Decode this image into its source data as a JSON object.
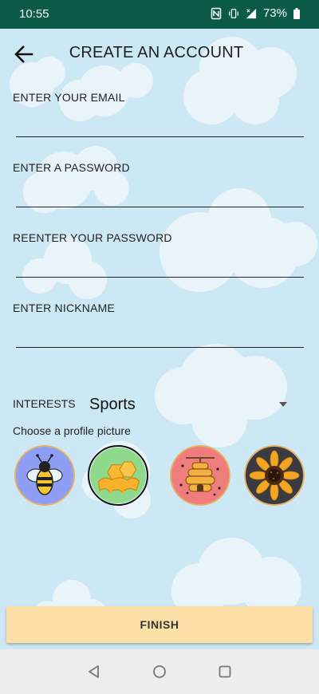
{
  "status_bar": {
    "time": "10:55",
    "battery": "73%",
    "icons": [
      "nfc-icon",
      "vibrate-icon",
      "signal-icon",
      "battery-icon"
    ],
    "background": "#0b5b48"
  },
  "header": {
    "title": "CREATE AN ACCOUNT",
    "back_icon": "arrow-left-icon"
  },
  "form": {
    "email": {
      "label": "ENTER YOUR EMAIL",
      "value": ""
    },
    "password": {
      "label": "ENTER A PASSWORD",
      "value": ""
    },
    "reenter_password": {
      "label": "REENTER YOUR PASSWORD",
      "value": ""
    },
    "nickname": {
      "label": "ENTER NICKNAME",
      "value": ""
    }
  },
  "interests": {
    "label": "INTERESTS",
    "selected": "Sports"
  },
  "profile_picture": {
    "label": "Choose a profile picture",
    "options": [
      {
        "name": "bee",
        "icon": "bee-icon",
        "background": "#8f9ef5",
        "selected": false
      },
      {
        "name": "honeycomb",
        "icon": "honeycomb-icon",
        "background": "#8fd98c",
        "selected": true
      },
      {
        "name": "beehive",
        "icon": "beehive-icon",
        "background": "#ef7d7d",
        "selected": false
      },
      {
        "name": "sunflower",
        "icon": "sunflower-icon",
        "background": "#3a3a40",
        "selected": false
      }
    ]
  },
  "finish_button": {
    "label": "FINISH",
    "color": "#fde0a8"
  },
  "nav_bar": {
    "icons": [
      "back-triangle-icon",
      "home-circle-icon",
      "recents-square-icon"
    ]
  },
  "theme": {
    "screen_background": "#cde8f5",
    "cloud_color": "#e9f4fa"
  }
}
